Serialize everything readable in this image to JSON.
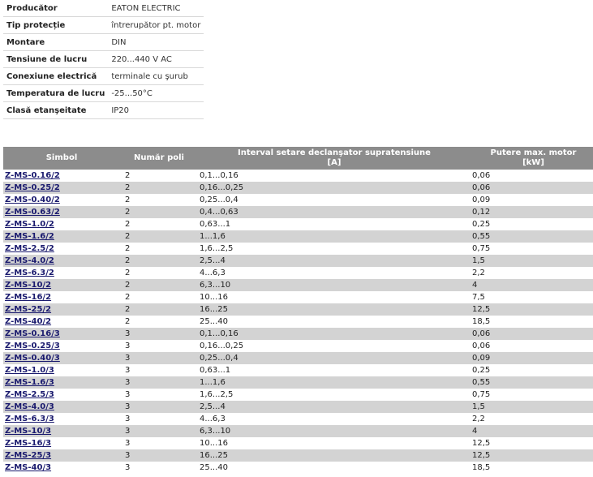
{
  "specs": [
    {
      "label": "Producător",
      "value": "EATON ELECTRIC"
    },
    {
      "label": "Tip protecție",
      "value": "întrerupător pt. motor"
    },
    {
      "label": "Montare",
      "value": "DIN"
    },
    {
      "label": "Tensiune de lucru",
      "value": "220...440 V AC"
    },
    {
      "label": "Conexiune electrică",
      "value": "terminale cu şurub"
    },
    {
      "label": "Temperatura de lucru",
      "value": "-25...50°C"
    },
    {
      "label": "Clasă etanşeitate",
      "value": "IP20"
    }
  ],
  "table": {
    "headers": {
      "symbol": "Simbol",
      "poles": "Număr poli",
      "interval": "Interval setare declanşator supratensiune",
      "interval_unit": "[A]",
      "power": "Putere max. motor",
      "power_unit": "[kW]"
    },
    "rows": [
      {
        "symbol": "Z-MS-0.16/2",
        "poles": "2",
        "interval": "0,1...0,16",
        "power": "0,06"
      },
      {
        "symbol": "Z-MS-0.25/2",
        "poles": "2",
        "interval": "0,16...0,25",
        "power": "0,06"
      },
      {
        "symbol": "Z-MS-0.40/2",
        "poles": "2",
        "interval": "0,25...0,4",
        "power": "0,09"
      },
      {
        "symbol": "Z-MS-0.63/2",
        "poles": "2",
        "interval": "0,4...0,63",
        "power": "0,12"
      },
      {
        "symbol": "Z-MS-1.0/2",
        "poles": "2",
        "interval": "0,63...1",
        "power": "0,25"
      },
      {
        "symbol": "Z-MS-1.6/2",
        "poles": "2",
        "interval": "1...1,6",
        "power": "0,55"
      },
      {
        "symbol": "Z-MS-2.5/2",
        "poles": "2",
        "interval": "1,6...2,5",
        "power": "0,75"
      },
      {
        "symbol": "Z-MS-4.0/2",
        "poles": "2",
        "interval": "2,5...4",
        "power": "1,5"
      },
      {
        "symbol": "Z-MS-6.3/2",
        "poles": "2",
        "interval": "4...6,3",
        "power": "2,2"
      },
      {
        "symbol": "Z-MS-10/2",
        "poles": "2",
        "interval": "6,3...10",
        "power": "4"
      },
      {
        "symbol": "Z-MS-16/2",
        "poles": "2",
        "interval": "10...16",
        "power": "7,5"
      },
      {
        "symbol": "Z-MS-25/2",
        "poles": "2",
        "interval": "16...25",
        "power": "12,5"
      },
      {
        "symbol": "Z-MS-40/2",
        "poles": "2",
        "interval": "25...40",
        "power": "18,5"
      },
      {
        "symbol": "Z-MS-0.16/3",
        "poles": "3",
        "interval": "0,1...0,16",
        "power": "0,06"
      },
      {
        "symbol": "Z-MS-0.25/3",
        "poles": "3",
        "interval": "0,16...0,25",
        "power": "0,06"
      },
      {
        "symbol": "Z-MS-0.40/3",
        "poles": "3",
        "interval": "0,25...0,4",
        "power": "0,09"
      },
      {
        "symbol": "Z-MS-1.0/3",
        "poles": "3",
        "interval": "0,63...1",
        "power": "0,25"
      },
      {
        "symbol": "Z-MS-1.6/3",
        "poles": "3",
        "interval": "1...1,6",
        "power": "0,55"
      },
      {
        "symbol": "Z-MS-2.5/3",
        "poles": "3",
        "interval": "1,6...2,5",
        "power": "0,75"
      },
      {
        "symbol": "Z-MS-4.0/3",
        "poles": "3",
        "interval": "2,5...4",
        "power": "1,5"
      },
      {
        "symbol": "Z-MS-6.3/3",
        "poles": "3",
        "interval": "4...6,3",
        "power": "2,2"
      },
      {
        "symbol": "Z-MS-10/3",
        "poles": "3",
        "interval": "6,3...10",
        "power": "4"
      },
      {
        "symbol": "Z-MS-16/3",
        "poles": "3",
        "interval": "10...16",
        "power": "12,5"
      },
      {
        "symbol": "Z-MS-25/3",
        "poles": "3",
        "interval": "16...25",
        "power": "12,5"
      },
      {
        "symbol": "Z-MS-40/3",
        "poles": "3",
        "interval": "25...40",
        "power": "18,5"
      }
    ]
  }
}
